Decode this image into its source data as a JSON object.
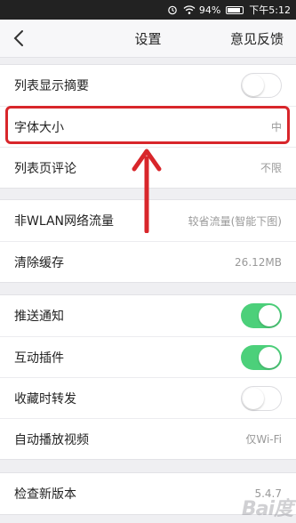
{
  "status_bar": {
    "battery": "94%",
    "time": "下午5:12",
    "icons": [
      "alarm-icon",
      "wifi-icon",
      "battery-icon"
    ]
  },
  "nav": {
    "back_icon": "chevron-left-icon",
    "title": "设置",
    "feedback": "意见反馈"
  },
  "groups": [
    {
      "rows": [
        {
          "label": "列表显示摘要",
          "control": "toggle",
          "on": false
        },
        {
          "label": "字体大小",
          "value": "中"
        },
        {
          "label": "列表页评论",
          "value": "不限"
        }
      ]
    },
    {
      "rows": [
        {
          "label": "非WLAN网络流量",
          "value": "较省流量(智能下图)"
        },
        {
          "label": "清除缓存",
          "value": "26.12MB"
        }
      ]
    },
    {
      "rows": [
        {
          "label": "推送通知",
          "control": "toggle",
          "on": true
        },
        {
          "label": "互动插件",
          "control": "toggle",
          "on": true
        },
        {
          "label": "收藏时转发",
          "control": "toggle",
          "on": false
        },
        {
          "label": "自动播放视频",
          "value": "仅Wi-Fi"
        }
      ]
    },
    {
      "rows": [
        {
          "label": "检查新版本",
          "value": "5.4.7"
        }
      ]
    }
  ],
  "annotation": {
    "highlight_color": "#d8262b"
  },
  "colors": {
    "toggle_on": "#4cd07a",
    "background": "#efeff2"
  }
}
